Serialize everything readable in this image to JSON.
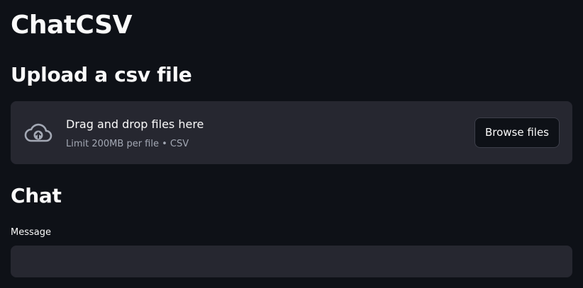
{
  "app": {
    "title": "ChatCSV"
  },
  "upload": {
    "heading": "Upload a csv file",
    "dropzone": {
      "icon": "cloud-upload-icon",
      "main_text": "Drag and drop files here",
      "sub_text": "Limit 200MB per file • CSV",
      "browse_label": "Browse files"
    }
  },
  "chat": {
    "heading": "Chat",
    "message_label": "Message",
    "message_value": "",
    "message_placeholder": ""
  },
  "colors": {
    "background": "#0e1117",
    "surface": "#262730",
    "text": "#fafafa",
    "muted_text": "#a3a8b4"
  }
}
